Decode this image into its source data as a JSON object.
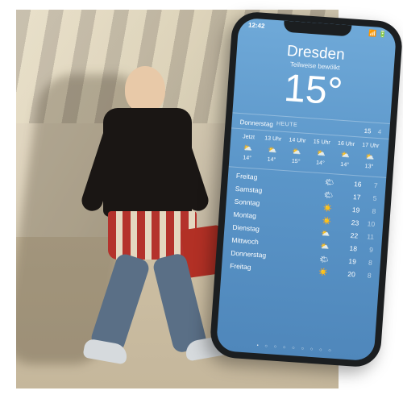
{
  "status": {
    "time": "12:42"
  },
  "city": "Dresden",
  "condition": "Teilweise bewölkt",
  "current_temp": "15°",
  "today": {
    "day": "Donnerstag",
    "tag": "HEUTE",
    "hi": "15",
    "lo": "4"
  },
  "hourly": [
    {
      "t": "Jetzt",
      "icon": "⛅",
      "temp": "14°"
    },
    {
      "t": "13 Uhr",
      "icon": "⛅",
      "temp": "14°"
    },
    {
      "t": "14 Uhr",
      "icon": "⛅",
      "temp": "15°"
    },
    {
      "t": "15 Uhr",
      "icon": "⛅",
      "temp": "14°"
    },
    {
      "t": "16 Uhr",
      "icon": "⛅",
      "temp": "14°"
    },
    {
      "t": "17 Uhr",
      "icon": "⛅",
      "temp": "13°"
    }
  ],
  "daily": [
    {
      "d": "Freitag",
      "icon": "🌤",
      "hi": "16",
      "lo": "7"
    },
    {
      "d": "Samstag",
      "icon": "🌤",
      "hi": "17",
      "lo": "5"
    },
    {
      "d": "Sonntag",
      "icon": "☀️",
      "hi": "19",
      "lo": "8"
    },
    {
      "d": "Montag",
      "icon": "☀️",
      "hi": "23",
      "lo": "10"
    },
    {
      "d": "Dienstag",
      "icon": "⛅",
      "hi": "22",
      "lo": "11"
    },
    {
      "d": "Mittwoch",
      "icon": "⛅",
      "hi": "18",
      "lo": "9"
    },
    {
      "d": "Donnerstag",
      "icon": "🌤",
      "hi": "19",
      "lo": "8"
    },
    {
      "d": "Freitag",
      "icon": "☀️",
      "hi": "20",
      "lo": "8"
    }
  ],
  "dots": "• ○ ○ ○ ○ ○ ○ ○ ○"
}
